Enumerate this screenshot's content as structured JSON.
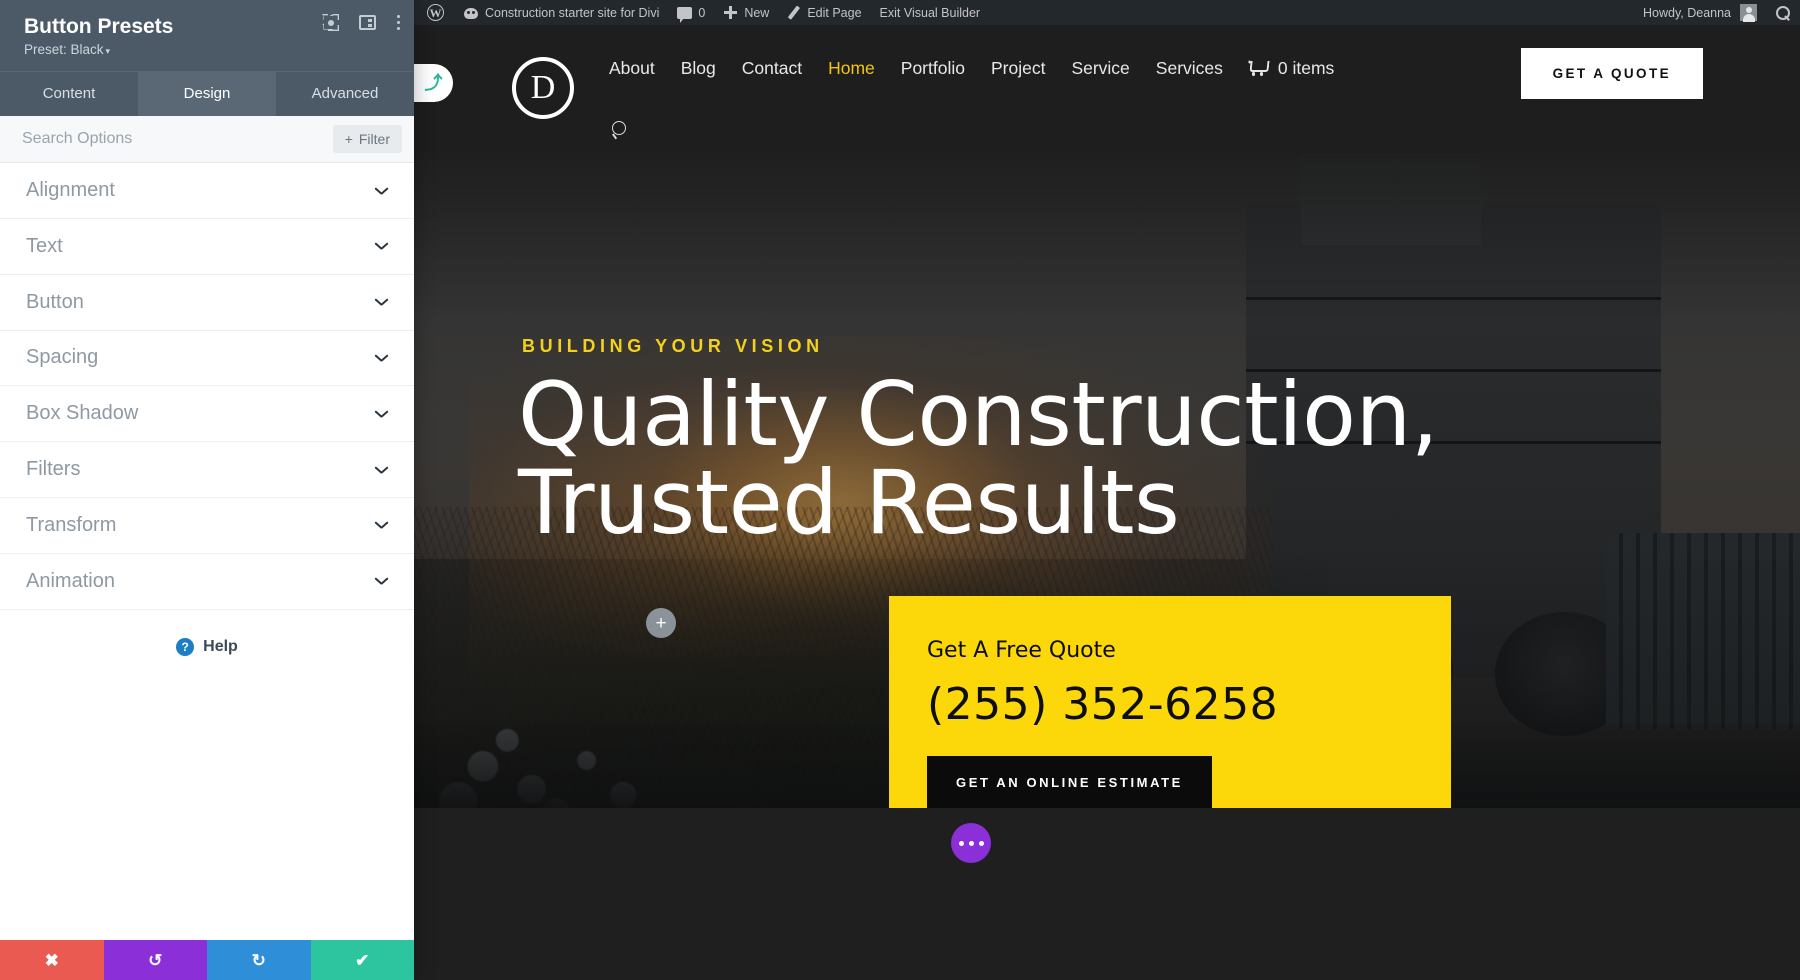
{
  "wp_adminbar": {
    "wp_logo_icon": "wordpress-logo-icon",
    "site_icon": "site-dashboard-icon",
    "site_name": "Construction starter site for Divi",
    "comments_icon": "comment-bubble-icon",
    "comments_count": "0",
    "new_icon": "plus-icon",
    "new_label": "New",
    "edit_icon": "pencil-icon",
    "edit_label": "Edit Page",
    "exit_label": "Exit Visual Builder",
    "howdy": "Howdy, Deanna",
    "avatar_icon": "user-avatar-icon",
    "search_icon": "search-icon"
  },
  "site_header": {
    "logo_letter": "D",
    "nav": [
      {
        "label": "About",
        "active": false
      },
      {
        "label": "Blog",
        "active": false
      },
      {
        "label": "Contact",
        "active": false
      },
      {
        "label": "Home",
        "active": true
      },
      {
        "label": "Portfolio",
        "active": false
      },
      {
        "label": "Project",
        "active": false
      },
      {
        "label": "Service",
        "active": false
      },
      {
        "label": "Services",
        "active": false
      }
    ],
    "cart_icon": "shopping-cart-icon",
    "cart_label": "0 items",
    "search_icon": "search-icon",
    "quote_button": "GET A QUOTE"
  },
  "hero": {
    "eyebrow": "BUILDING YOUR VISION",
    "title_line1": "Quality Construction,",
    "title_line2": "Trusted Results",
    "plus_hotspot_icon": "add-module-icon",
    "quote_card": {
      "label": "Get A Free Quote",
      "phone": "(255) 352-6258",
      "button": "GET AN ONLINE ESTIMATE",
      "background_color": "#fcd80b"
    }
  },
  "footer_strip": {
    "more_fab_icon": "ellipsis-icon"
  },
  "divi_panel": {
    "title": "Button Presets",
    "subtitle": "Preset: Black",
    "subtitle_caret": "▾",
    "head_icons": [
      {
        "name": "focus-target-icon"
      },
      {
        "name": "panel-layout-icon"
      },
      {
        "name": "kebab-menu-icon"
      }
    ],
    "tabs": [
      {
        "label": "Content",
        "active": false
      },
      {
        "label": "Design",
        "active": true
      },
      {
        "label": "Advanced",
        "active": false
      }
    ],
    "search_placeholder": "Search Options",
    "search_value": "",
    "filter_label": "Filter",
    "filter_icon": "plus-icon",
    "sections": [
      {
        "label": "Alignment"
      },
      {
        "label": "Text"
      },
      {
        "label": "Button"
      },
      {
        "label": "Spacing"
      },
      {
        "label": "Box Shadow"
      },
      {
        "label": "Filters"
      },
      {
        "label": "Transform"
      },
      {
        "label": "Animation"
      }
    ],
    "help_label": "Help",
    "help_icon": "question-mark-icon",
    "actions": [
      {
        "name": "cancel",
        "icon": "close-icon",
        "glyph": "✖",
        "color": "#ea5a51"
      },
      {
        "name": "undo",
        "icon": "undo-icon",
        "glyph": "↺",
        "color": "#8b2fd8"
      },
      {
        "name": "redo",
        "icon": "redo-icon",
        "glyph": "↻",
        "color": "#2e8fd8"
      },
      {
        "name": "save",
        "icon": "check-icon",
        "glyph": "✔",
        "color": "#2dc4a0"
      }
    ],
    "handle_icon": "collapse-panel-icon",
    "handle_glyph": "⤴"
  }
}
